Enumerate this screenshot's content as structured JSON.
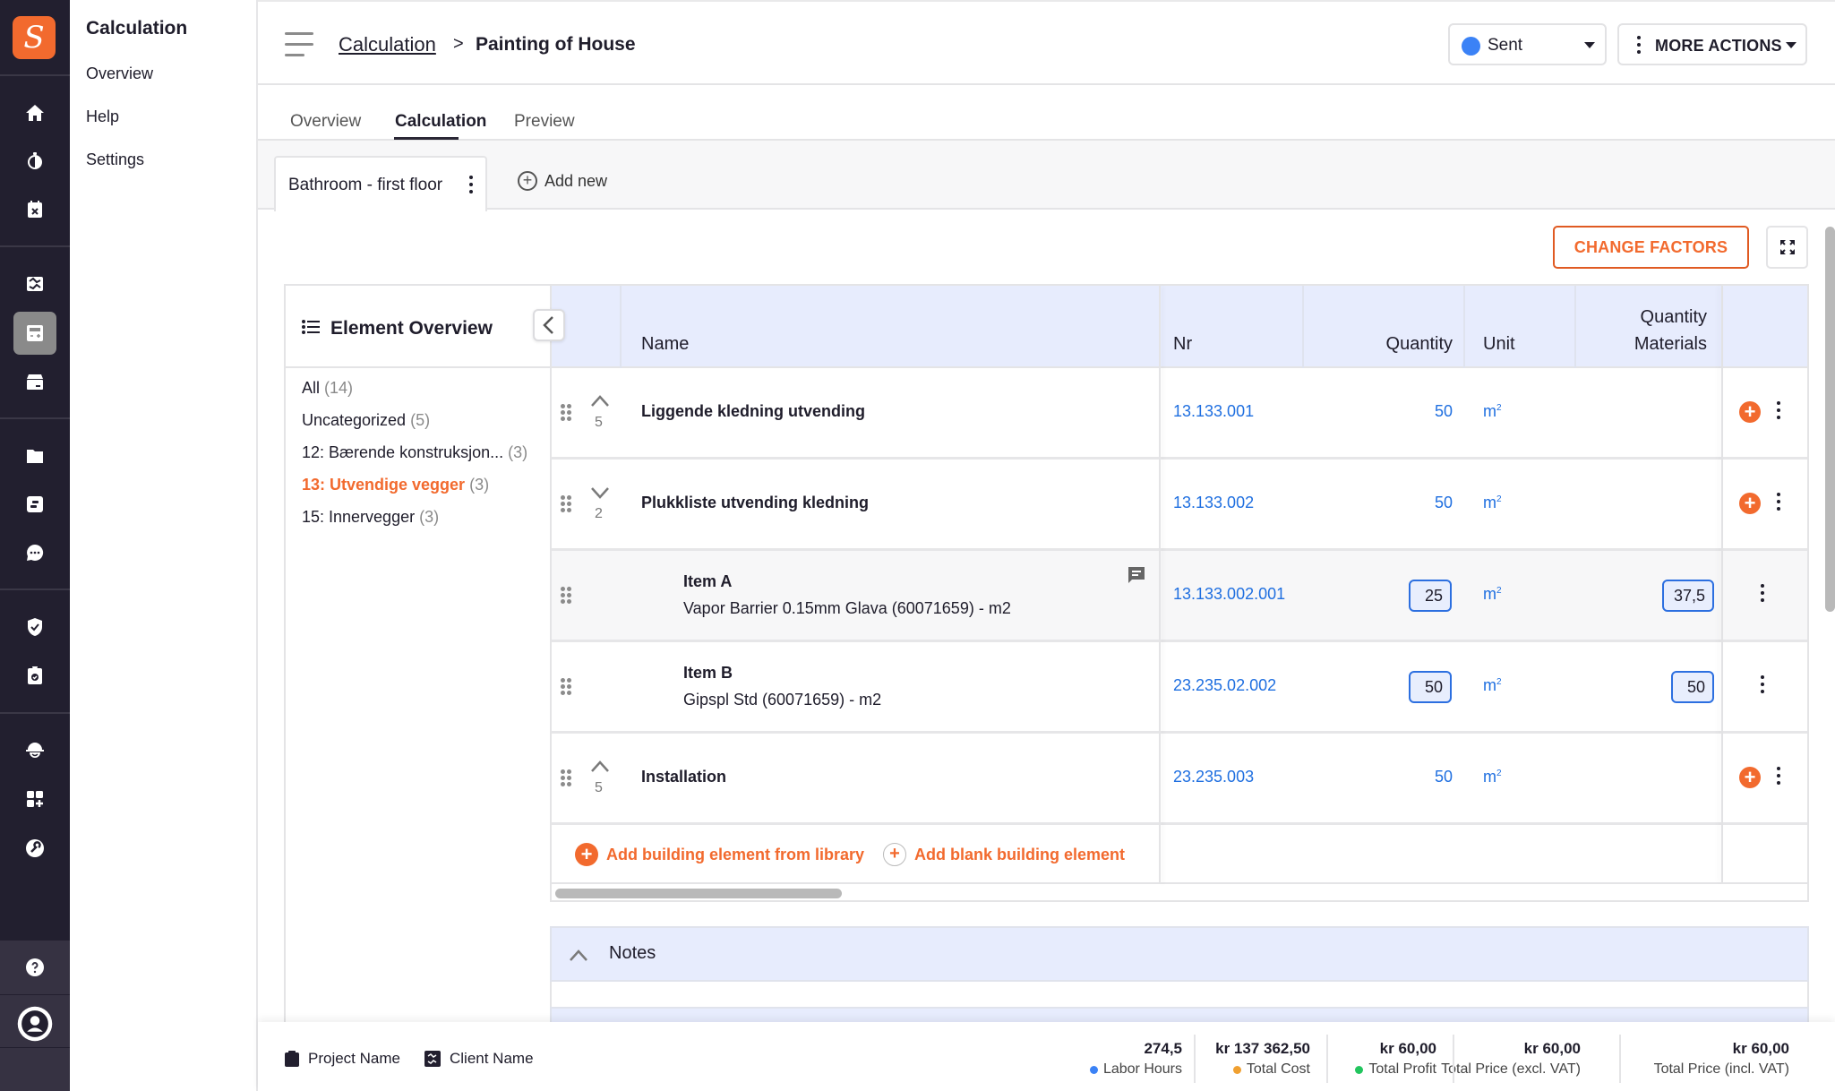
{
  "app": {
    "logo_glyph": "S",
    "brand_color": "#f26a2e"
  },
  "rail": {
    "icons": [
      "home-icon",
      "timer-icon",
      "calendar-cancel-icon",
      "handshake-icon",
      "calculator-icon",
      "box-icon",
      "folder-icon",
      "board-icon",
      "chat-icon",
      "shield-check-icon",
      "clipboard-check-icon",
      "worker-helmet-icon",
      "add-widget-icon",
      "wrench-icon",
      "help-icon",
      "user-account-icon"
    ],
    "active": "calculator-icon"
  },
  "subnav": {
    "title": "Calculation",
    "items": [
      "Overview",
      "Help",
      "Settings"
    ]
  },
  "header": {
    "breadcrumb_parent": "Calculation",
    "breadcrumb_sep": ">",
    "breadcrumb_current": "Painting of House",
    "status": {
      "label": "Sent",
      "color": "#3b82f6"
    },
    "more_actions_label": "MORE ACTIONS"
  },
  "tabs": [
    {
      "label": "Overview",
      "active": false
    },
    {
      "label": "Calculation",
      "active": true
    },
    {
      "label": "Preview",
      "active": false
    }
  ],
  "subtabs": {
    "current": "Bathroom - first floor",
    "add_new": "Add new"
  },
  "toolbar": {
    "change_factors": "CHANGE FACTORS"
  },
  "overview": {
    "title": "Element Overview",
    "items": [
      {
        "name": "All",
        "count": "(14)",
        "active": false
      },
      {
        "name": "Uncategorized",
        "count": "(5)",
        "active": false
      },
      {
        "name": "12: Bærende konstruksjon...",
        "count": "(3)",
        "active": false
      },
      {
        "name": "13: Utvendige vegger",
        "count": "(3)",
        "active": true
      },
      {
        "name": "15: Innervegger",
        "count": "(3)",
        "active": false
      }
    ]
  },
  "table": {
    "columns": {
      "name": "Name",
      "nr": "Nr",
      "quantity": "Quantity",
      "unit": "Unit",
      "qty_materials_1": "Quantity",
      "qty_materials_2": "Materials"
    },
    "rows": [
      {
        "type": "element",
        "expanded": true,
        "count": "5",
        "name": "Liggende kledning utvending",
        "nr": "13.133.001",
        "quantity": "50",
        "unit": "m",
        "unit_sup": "2"
      },
      {
        "type": "element",
        "expanded": false,
        "count": "2",
        "name": "Plukkliste utvending kledning",
        "nr": "13.133.002",
        "quantity": "50",
        "unit": "m",
        "unit_sup": "2"
      },
      {
        "type": "item",
        "name": "Item A",
        "desc": "Vapor Barrier 0.15mm Glava (60071659) - m2",
        "nr": "13.133.002.001",
        "quantity": "25",
        "unit": "m",
        "unit_sup": "2",
        "qty_materials": "37,5",
        "has_comment": true
      },
      {
        "type": "item",
        "name": "Item B",
        "desc": "Gipspl Std  (60071659) - m2",
        "nr": "23.235.02.002",
        "quantity": "50",
        "unit": "m",
        "unit_sup": "2",
        "qty_materials": "50",
        "has_comment": false
      },
      {
        "type": "element",
        "expanded": true,
        "count": "5",
        "name": "Installation",
        "nr": "23.235.003",
        "quantity": "50",
        "unit": "m",
        "unit_sup": "2"
      }
    ],
    "add_from_library": "Add building element from library",
    "add_blank": "Add blank building element"
  },
  "notes": {
    "label": "Notes"
  },
  "footer": {
    "project_name": "Project Name",
    "client_name": "Client Name",
    "stats": [
      {
        "value": "274,5",
        "label": "Labor Hours",
        "dot": "#3b82f6"
      },
      {
        "value": "kr 137 362,50",
        "label": "Total Cost",
        "dot": "#f0a030"
      },
      {
        "value": "kr 60,00",
        "label": "Total Profit",
        "dot": "#22c55e"
      },
      {
        "value": "kr 60,00",
        "label": "Total Price (excl. VAT)",
        "dot": null
      },
      {
        "value": "kr 60,00",
        "label": "Total Price (incl. VAT)",
        "dot": null
      }
    ]
  }
}
